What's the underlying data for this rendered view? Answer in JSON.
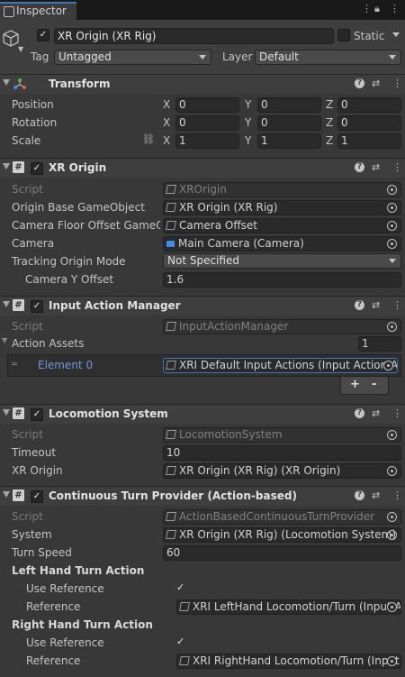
{
  "tab": {
    "title": "Inspector"
  },
  "object": {
    "active": true,
    "name": "XR Origin (XR Rig)",
    "static_label": "Static",
    "tag_label": "Tag",
    "tag_value": "Untagged",
    "layer_label": "Layer",
    "layer_value": "Default"
  },
  "transform": {
    "title": "Transform",
    "position": {
      "label": "Position",
      "x": "0",
      "y": "0",
      "z": "0"
    },
    "rotation": {
      "label": "Rotation",
      "x": "0",
      "y": "0",
      "z": "0"
    },
    "scale": {
      "label": "Scale",
      "x": "1",
      "y": "1",
      "z": "1"
    },
    "axes": {
      "x": "X",
      "y": "Y",
      "z": "Z"
    }
  },
  "xr_origin": {
    "title": "XR Origin",
    "enabled": true,
    "script_label": "Script",
    "script_value": "XROrigin",
    "base_label": "Origin Base GameObject",
    "base_value": "XR Origin (XR Rig)",
    "floor_label": "Camera Floor Offset GameOb",
    "floor_value": "Camera Offset",
    "camera_label": "Camera",
    "camera_value": "Main Camera (Camera)",
    "tracking_label": "Tracking Origin Mode",
    "tracking_value": "Not Specified",
    "yoffset_label": "Camera Y Offset",
    "yoffset_value": "1.6"
  },
  "input_action_manager": {
    "title": "Input Action Manager",
    "enabled": true,
    "script_label": "Script",
    "script_value": "InputActionManager",
    "assets_label": "Action Assets",
    "assets_count": "1",
    "element_label": "Element 0",
    "element_value": "XRI Default Input Actions (Input Action A",
    "add_label": "+",
    "remove_label": "-"
  },
  "locomotion_system": {
    "title": "Locomotion System",
    "enabled": true,
    "script_label": "Script",
    "script_value": "LocomotionSystem",
    "timeout_label": "Timeout",
    "timeout_value": "10",
    "origin_label": "XR Origin",
    "origin_value": "XR Origin (XR Rig) (XR Origin)"
  },
  "turn_provider": {
    "title": "Continuous Turn Provider (Action-based)",
    "enabled": true,
    "script_label": "Script",
    "script_value": "ActionBasedContinuousTurnProvider",
    "system_label": "System",
    "system_value": "XR Origin (XR Rig) (Locomotion System)",
    "speed_label": "Turn Speed",
    "speed_value": "60",
    "left_header": "Left Hand Turn Action",
    "left_use_label": "Use Reference",
    "left_use": true,
    "left_ref_label": "Reference",
    "left_ref_value": "XRI LeftHand Locomotion/Turn (Input A",
    "right_header": "Right Hand Turn Action",
    "right_use_label": "Use Reference",
    "right_use": true,
    "right_ref_label": "Reference",
    "right_ref_value": "XRI RightHand Locomotion/Turn (Input"
  }
}
